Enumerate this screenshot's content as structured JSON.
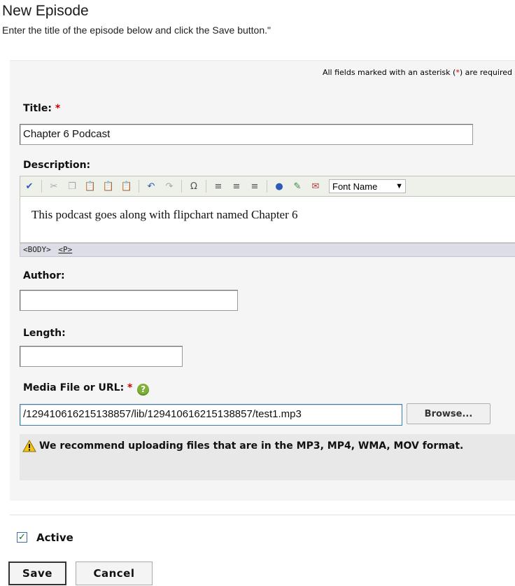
{
  "page": {
    "title": "New Episode",
    "subtitle": "Enter the title of the episode below and click the Save button.\""
  },
  "form": {
    "required_note_prefix": "All fields marked with an asterisk (",
    "required_note_star": "*",
    "required_note_suffix": ") are required",
    "required_star": "*",
    "title": {
      "label": "Title:",
      "value": "Chapter 6 Podcast"
    },
    "description": {
      "label": "Description:",
      "content": "This podcast goes along with flipchart named Chapter 6",
      "status_tags": [
        "<BODY>",
        "<P>"
      ],
      "font_select": "Font Name"
    },
    "author": {
      "label": "Author:",
      "value": ""
    },
    "length": {
      "label": "Length:",
      "value": ""
    },
    "media": {
      "label": "Media File or URL:",
      "value": "/129410616215138857/lib/129410616215138857/test1.mp3",
      "browse_label": "Browse...",
      "help_glyph": "?"
    },
    "warning": "We recommend uploading files that are in the MP3, MP4, WMA, MOV format."
  },
  "toolbar_icons": [
    "spellcheck-icon",
    "cut-icon",
    "copy-icon",
    "paste-icon",
    "paste-word-icon",
    "paste-text-icon",
    "undo-icon",
    "redo-icon",
    "special-char-icon",
    "align-left-icon",
    "align-center-icon",
    "align-right-icon",
    "link-icon",
    "image-icon",
    "media-icon"
  ],
  "active": {
    "label": "Active",
    "checked": true
  },
  "actions": {
    "save_label": "Save",
    "cancel_label": "Cancel"
  },
  "colors": {
    "required": "#cc0000",
    "panel": "#f5f5f5",
    "warning_bg": "#e8e8e8"
  }
}
